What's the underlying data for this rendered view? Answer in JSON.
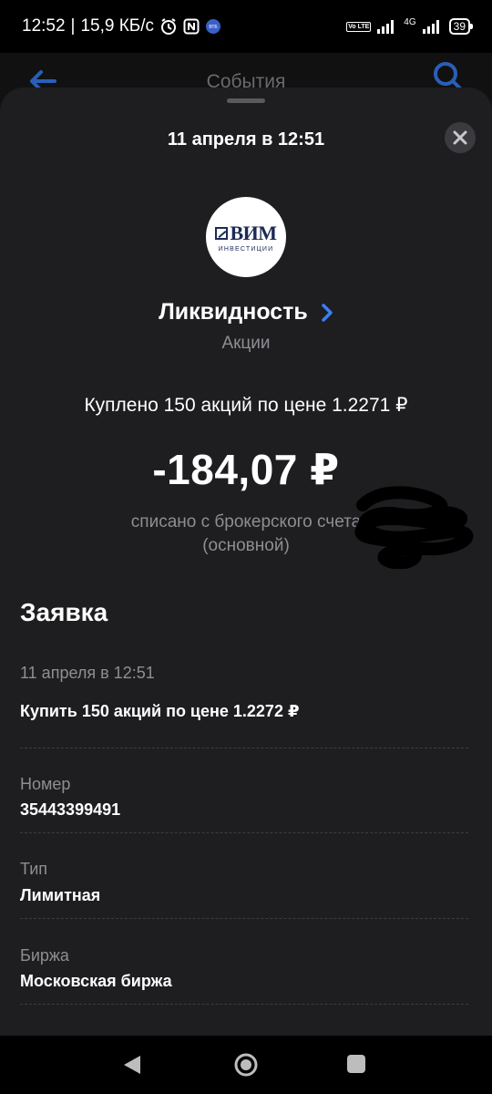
{
  "status_bar": {
    "time": "12:52",
    "separator": "|",
    "speed": "15,9 КБ/с",
    "network_label": "4G",
    "volte_label": "Vo LTE",
    "battery": "39"
  },
  "background_header": {
    "title": "События"
  },
  "sheet": {
    "date": "11 апреля в 12:51",
    "logo": {
      "brand": "ВИМ",
      "subtitle": "ИНВЕСТИЦИИ"
    },
    "fund_name": "Ликвидность",
    "fund_type": "Акции",
    "trade_description": "Куплено 150 акций по цене 1.2271 ₽",
    "amount": "-184,07 ₽",
    "debit_line1": "списано с брокерского счета",
    "debit_line2": "(основной)",
    "order": {
      "section_title": "Заявка",
      "date": "11 апреля в 12:51",
      "description": "Купить 150 акций по цене 1.2272 ₽",
      "fields": [
        {
          "label": "Номер",
          "value": "35443399491"
        },
        {
          "label": "Тип",
          "value": "Лимитная"
        },
        {
          "label": "Биржа",
          "value": "Московская биржа"
        }
      ]
    }
  },
  "colors": {
    "sheet_bg": "#1e1e20",
    "accent_blue": "#3a7ff5",
    "secondary_text": "#8e8e93"
  },
  "icons": {
    "back": "arrow-left-icon",
    "search": "search-icon",
    "close": "close-icon",
    "chevron": "chevron-right-icon"
  }
}
